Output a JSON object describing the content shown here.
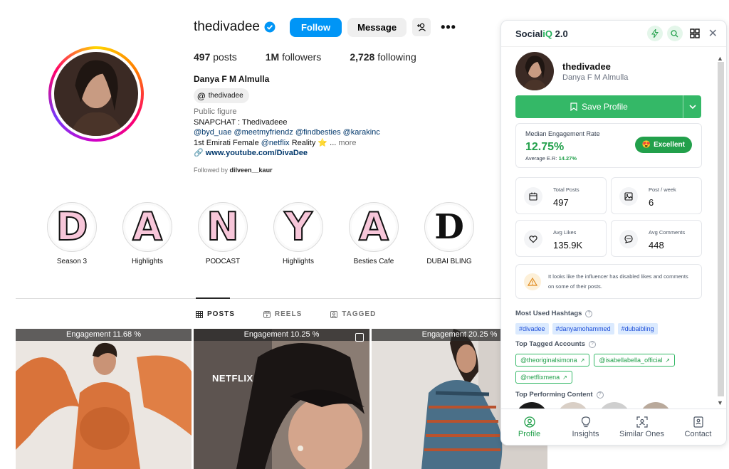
{
  "profile": {
    "username": "thedivadee",
    "follow_label": "Follow",
    "message_label": "Message",
    "more_label": "•••",
    "stats": [
      {
        "value": "497",
        "label": "posts"
      },
      {
        "value": "1M",
        "label": "followers"
      },
      {
        "value": "2,728",
        "label": "following"
      }
    ],
    "full_name": "Danya F M Almulla",
    "threads_handle": "thedivadee",
    "bio": {
      "category": "Public figure",
      "line1": "SNAPCHAT : Thedivadeee",
      "mentions": [
        "@byd_uae",
        "@meetmyfriendz",
        "@findbesties",
        "@karakinc"
      ],
      "line3_prefix": "1st Emirati Female ",
      "line3_mention": "@netflix",
      "line3_suffix": " Reality ⭐ ...",
      "more": "more",
      "link": "www.youtube.com/DivaDee"
    },
    "followed_by_prefix": "Followed by ",
    "followed_by_user": "dilveen__kaur"
  },
  "highlights": [
    {
      "letter": "D",
      "label": "Season 3"
    },
    {
      "letter": "A",
      "label": "Highlights"
    },
    {
      "letter": "N",
      "label": "PODCAST"
    },
    {
      "letter": "Y",
      "label": "Highlights"
    },
    {
      "letter": "A",
      "label": "Besties Cafe"
    },
    {
      "letter": "D",
      "label": "DUBAI BLING"
    }
  ],
  "tabs": [
    {
      "label": "POSTS",
      "icon": "grid-icon"
    },
    {
      "label": "REELS",
      "icon": "reels-icon"
    },
    {
      "label": "TAGGED",
      "icon": "tagged-icon"
    }
  ],
  "posts": [
    {
      "engagement": "Engagement 11.68 %"
    },
    {
      "engagement": "Engagement 10.25 %",
      "overlay_text": "NETFLIX"
    },
    {
      "engagement": "Engagement 20.25 %"
    }
  ],
  "panel": {
    "logo_prefix": "Social",
    "logo_iq": "iQ",
    "logo_suffix": " 2.0",
    "close": "✕",
    "username": "thedivadee",
    "full_name": "Danya F M Almulla",
    "save_label": "Save Profile",
    "engagement": {
      "title": "Median Engagement Rate",
      "value": "12.75%",
      "avg_label": "Average E.R: ",
      "avg_value": "14.27%",
      "badge": "Excellent"
    },
    "stats": [
      {
        "label": "Total Posts",
        "value": "497",
        "icon": "calendar-icon"
      },
      {
        "label": "Post / week",
        "value": "6",
        "icon": "image-icon"
      },
      {
        "label": "Avg Likes",
        "value": "135.9K",
        "icon": "heart-icon"
      },
      {
        "label": "Avg Comments",
        "value": "448",
        "icon": "comment-icon"
      }
    ],
    "warning": "It looks like the influencer has disabled likes and comments on some of their posts.",
    "hashtags_title": "Most Used Hashtags",
    "hashtags": [
      "#divadee",
      "#danyamohammed",
      "#dubaibling"
    ],
    "accounts_title": "Top Tagged Accounts",
    "accounts": [
      "@theoriginalsimona",
      "@isabellabella_official",
      "@netflixmena"
    ],
    "content_title": "Top Performing Content",
    "nav": [
      {
        "label": "Profile",
        "icon": "person-icon",
        "active": true
      },
      {
        "label": "Insights",
        "icon": "bulb-icon"
      },
      {
        "label": "Similar Ones",
        "icon": "similar-icon"
      },
      {
        "label": "Contact",
        "icon": "contact-icon"
      }
    ]
  },
  "colors": {
    "ig_blue": "#0095f6",
    "socialiq_green": "#34b867",
    "tag_blue": "#1d4ed8"
  }
}
